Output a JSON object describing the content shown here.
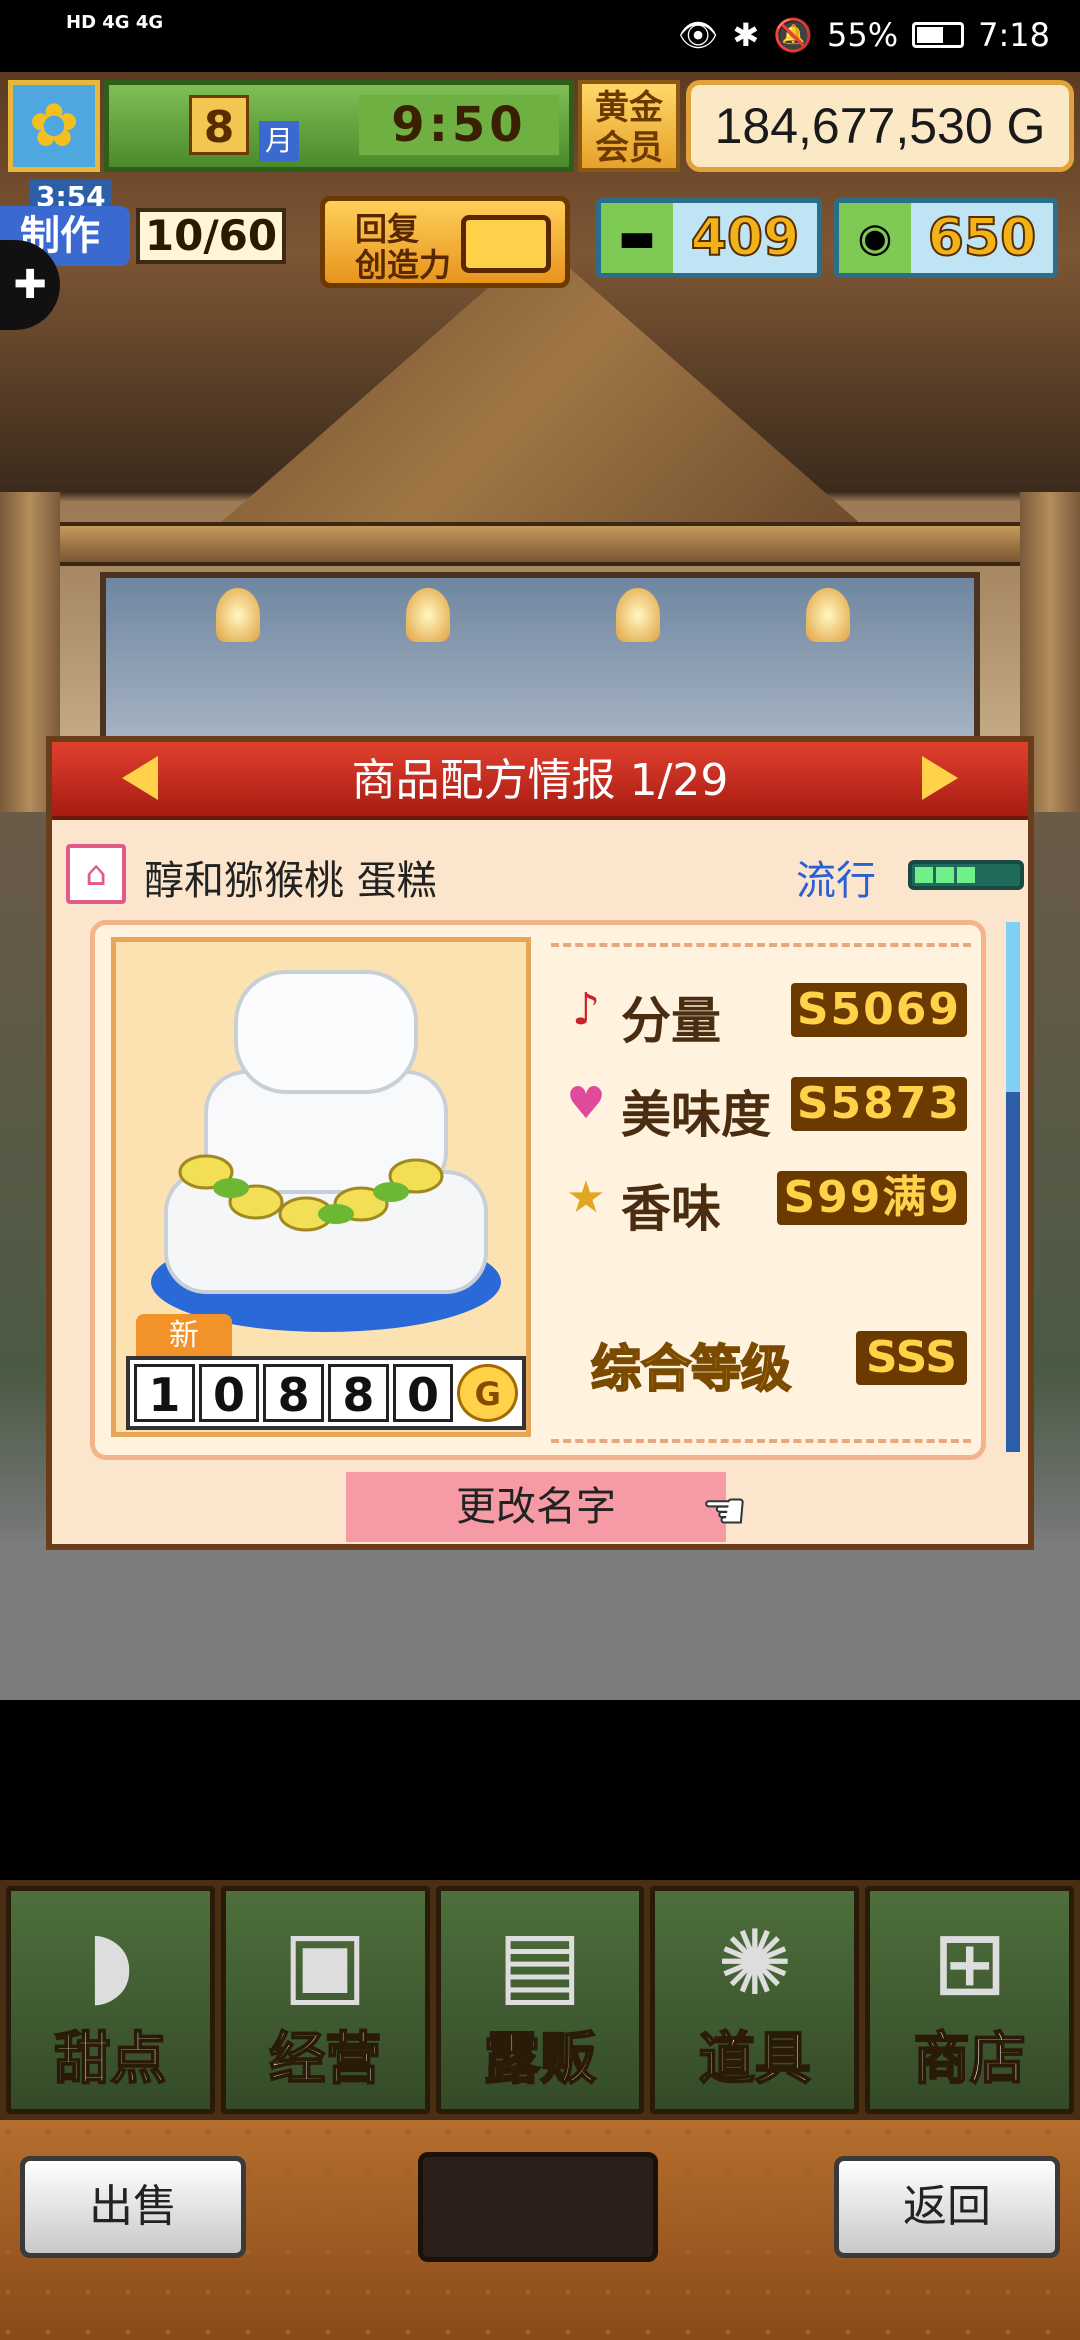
{
  "status_bar": {
    "network_left": "HD 4G 4G",
    "battery": "55%",
    "time": "7:18"
  },
  "hud": {
    "month": "8",
    "month_unit": "月",
    "clock": "9:50",
    "member": "黄金\n会员",
    "money": "184,677,530 G",
    "stamina_timer": "3:54",
    "stamina_label": "制作",
    "stamina_value": "10/60",
    "restore_label": "回复\n创造力",
    "ticket_count": "409",
    "medal_count": "650"
  },
  "dialog": {
    "title": "商品配方情报 1/29",
    "recipe_name": "醇和猕猴桃 蛋糕",
    "trend_label": "流行",
    "new_tag": "新",
    "price_digits": [
      "1",
      "0",
      "8",
      "8",
      "0"
    ],
    "price_unit": "G",
    "stats": [
      {
        "icon": "♪",
        "label": "分量",
        "value": "S5069"
      },
      {
        "icon": "♥",
        "label": "美味度",
        "value": "S5873"
      },
      {
        "icon": "★",
        "label": "香味",
        "value": "S99满9"
      }
    ],
    "overall_label": "综合等级",
    "overall_value": "SSS",
    "rename_button": "更改名字"
  },
  "menu": [
    {
      "label": "甜点",
      "icon": "cake-icon"
    },
    {
      "label": "经营",
      "icon": "shop-icon"
    },
    {
      "label": "露贩",
      "icon": "truck-icon"
    },
    {
      "label": "道具",
      "icon": "items-icon"
    },
    {
      "label": "商店",
      "icon": "cart-icon"
    }
  ],
  "bottom": {
    "sell": "出售",
    "back": "返回"
  },
  "colors": {
    "dialog_header": "#c0291a",
    "panel_bg": "#fbe5cc",
    "menu_bg": "#3f5a30"
  }
}
